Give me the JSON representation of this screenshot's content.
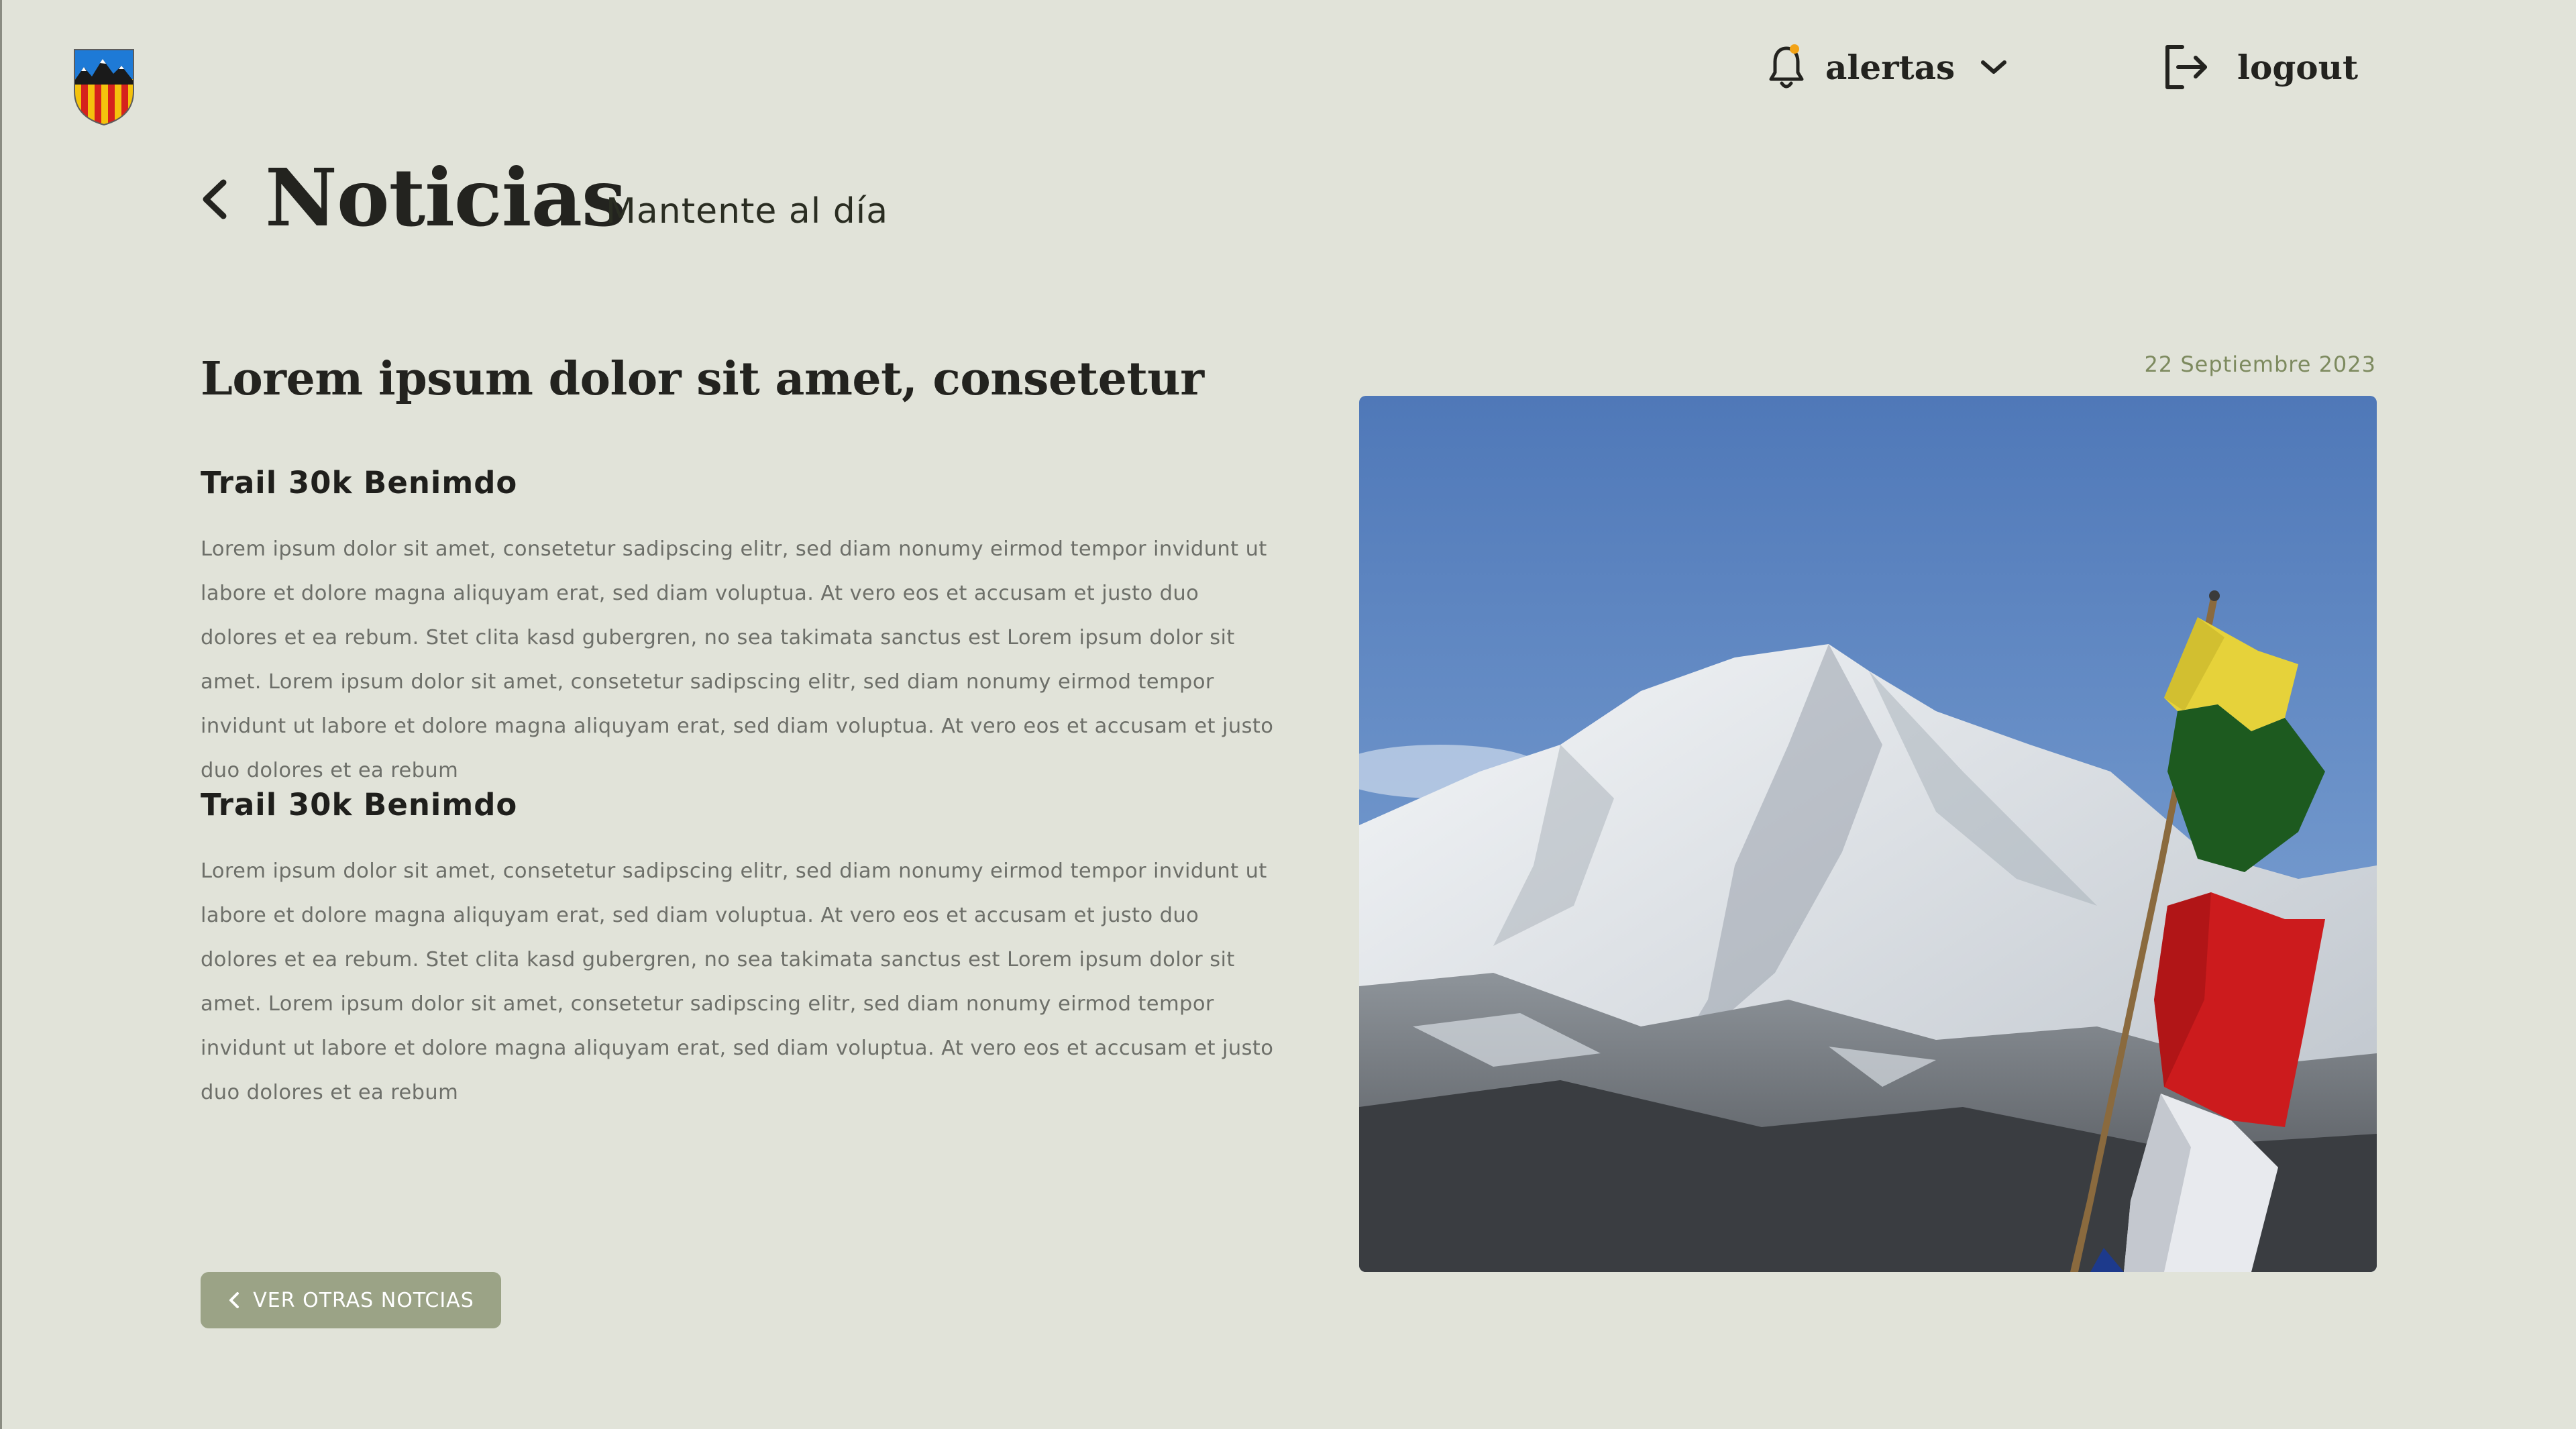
{
  "header": {
    "logo_icon": "shield-crest-icon",
    "alerts_label": "alertas",
    "alerts_icon": "bell-icon",
    "alerts_dot_color": "#f2a316",
    "logout_label": "logout",
    "logout_icon": "logout-icon"
  },
  "page": {
    "title": "Noticias",
    "subtitle": "Mantente al día",
    "back_icon": "chevron-left-icon"
  },
  "article": {
    "title": "Lorem ipsum dolor sit amet, consetetur",
    "date": "22 Septiembre 2023",
    "sections": [
      {
        "heading": "Trail 30k Benimdo",
        "body": "Lorem ipsum dolor sit amet, consetetur sadipscing elitr, sed diam nonumy eirmod tempor invidunt ut labore et dolore magna aliquyam erat, sed diam voluptua. At vero eos et accusam et justo duo dolores et ea rebum. Stet clita kasd gubergren, no sea takimata sanctus est Lorem ipsum dolor sit amet. Lorem ipsum dolor sit amet, consetetur sadipscing elitr, sed diam nonumy eirmod tempor invidunt ut labore et dolore magna aliquyam erat, sed diam voluptua. At vero eos et accusam et justo duo dolores et ea rebum"
      },
      {
        "heading": "Trail 30k Benimdo",
        "body": "Lorem ipsum dolor sit amet, consetetur sadipscing elitr, sed diam nonumy eirmod tempor invidunt ut labore et dolore magna aliquyam erat, sed diam voluptua. At vero eos et accusam et justo duo dolores et ea rebum. Stet clita kasd gubergren, no sea takimata sanctus est Lorem ipsum dolor sit amet. Lorem ipsum dolor sit amet, consetetur sadipscing elitr, sed diam nonumy eirmod tempor invidunt ut labore et dolore magna aliquyam erat, sed diam voluptua. At vero eos et accusam et justo duo dolores et ea rebum"
      }
    ],
    "more_button_label": "VER OTRAS NOTCIAS",
    "photo_subject": "snowy mountain with prayer flags"
  },
  "colors": {
    "background": "#e1e3d9",
    "accent": "#9ba386",
    "date": "#7d8a5f"
  }
}
